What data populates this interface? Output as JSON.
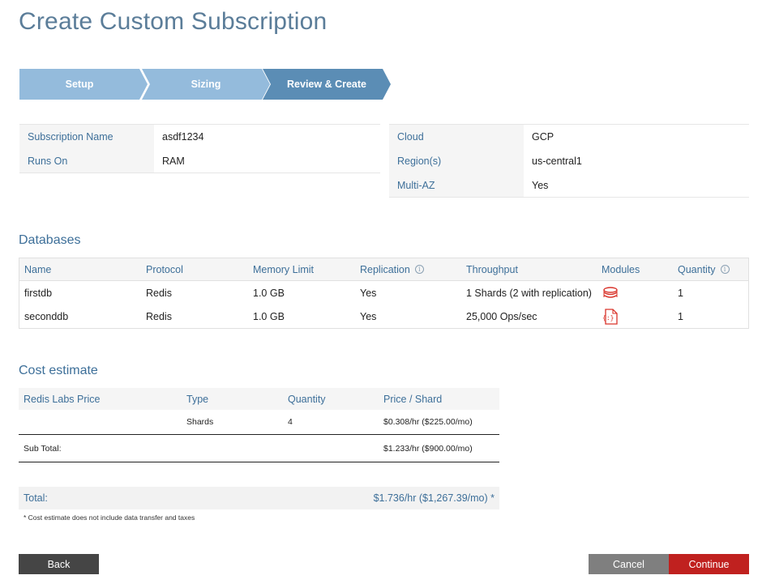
{
  "page": {
    "title": "Create Custom Subscription"
  },
  "stepper": {
    "steps": [
      "Setup",
      "Sizing",
      "Review & Create"
    ]
  },
  "summary_left": {
    "rows": [
      {
        "label": "Subscription Name",
        "value": "asdf1234"
      },
      {
        "label": "Runs On",
        "value": "RAM"
      }
    ]
  },
  "summary_right": {
    "rows": [
      {
        "label": "Cloud",
        "value": "GCP"
      },
      {
        "label": "Region(s)",
        "value": "us-central1"
      },
      {
        "label": "Multi-AZ",
        "value": "Yes"
      }
    ]
  },
  "databases": {
    "title": "Databases",
    "columns": [
      "Name",
      "Protocol",
      "Memory Limit",
      "Replication",
      "Throughput",
      "Modules",
      "Quantity"
    ],
    "info_icon": "i",
    "rows": [
      {
        "name": "firstdb",
        "protocol": "Redis",
        "memory": "1.0 GB",
        "replication": "Yes",
        "throughput": "1 Shards (2 with replication)",
        "module_icon": "redis-stack-icon",
        "quantity": "1"
      },
      {
        "name": "seconddb",
        "protocol": "Redis",
        "memory": "1.0 GB",
        "replication": "Yes",
        "throughput": "25,000 Ops/sec",
        "module_icon": "json-document-icon",
        "quantity": "1"
      }
    ]
  },
  "cost": {
    "title": "Cost estimate",
    "columns": [
      "Redis Labs Price",
      "Type",
      "Quantity",
      "Price / Shard"
    ],
    "rows": [
      {
        "price": "",
        "type": "Shards",
        "quantity": "4",
        "per_shard": "$0.308/hr ($225.00/mo)"
      }
    ],
    "subtotal_label": "Sub Total:",
    "subtotal_value": "$1.233/hr ($900.00/mo)",
    "total_label": "Total:",
    "total_value": "$1.736/hr ($1,267.39/mo) *",
    "note": "* Cost estimate does not include data transfer and taxes"
  },
  "buttons": {
    "back": "Back",
    "cancel": "Cancel",
    "continue": "Continue"
  },
  "colors": {
    "step_light": "#94bbdc",
    "step_active": "#5b8db5",
    "cancel": "#7f7f7f",
    "continue": "#c0211f",
    "back": "#454545",
    "accent": "#3d6f99"
  }
}
